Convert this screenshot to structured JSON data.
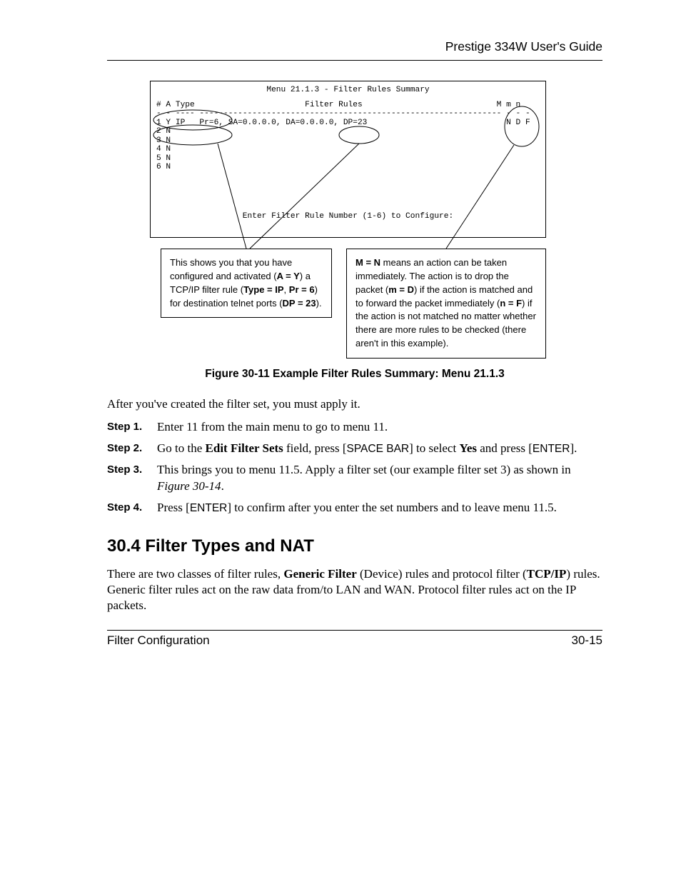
{
  "header": {
    "guide_title": "Prestige 334W User's Guide"
  },
  "terminal": {
    "title": "Menu 21.1.3 - Filter Rules Summary",
    "col_header": "# A Type                       Filter Rules                            M m n",
    "col_divider": "- - ---- --------------------------------------------------------------- - - -",
    "rows": [
      "1 Y IP   Pr=6, SA=0.0.0.0, DA=0.0.0.0, DP=23                             N D F",
      "2 N",
      "3 N",
      "4 N",
      "5 N",
      "6 N"
    ],
    "prompt": "Enter Filter Rule Number (1-6) to Configure:"
  },
  "callouts": {
    "left": {
      "t1": "This shows you that you have configured and activated (",
      "b1": "A = Y",
      "t2": ") a TCP/IP filter rule (",
      "b2": "Type = IP",
      "t3": ", ",
      "b3": "Pr = 6",
      "t4": ") for destination telnet ports (",
      "b4": "DP = 23",
      "t5": ")."
    },
    "right": {
      "b1": "M = N",
      "t1": " means an action can be taken immediately. The action is to drop the packet (",
      "b2": "m = D",
      "t2": ") if the action is matched and to forward the packet immediately (",
      "b3": "n = F",
      "t3": ") if the action is not matched no matter whether there are more rules to be checked (there aren't in this example)."
    }
  },
  "figure_caption": "Figure 30-11 Example Filter Rules Summary: Menu 21.1.3",
  "intro_para": "After you've created the filter set, you must apply it.",
  "steps": [
    {
      "label": "Step 1.",
      "plain": "Enter 11 from the main menu to go to menu 11."
    },
    {
      "label": "Step 2.",
      "pre": "Go to the ",
      "b1": "Edit Filter Sets",
      "mid1": " field, press [",
      "ss1": "SPACE BAR",
      "mid2": "] to select ",
      "b2": "Yes",
      "mid3": " and press [",
      "ss2": "ENTER",
      "post": "]."
    },
    {
      "label": "Step 3.",
      "pre": "This brings you to menu 11.5. Apply a filter set (our example filter set 3) as shown in ",
      "it": "Figure 30-14",
      "post": "."
    },
    {
      "label": "Step 4.",
      "pre": "Press [",
      "ss1": "ENTER",
      "post": "] to confirm after you enter the set numbers and to leave menu 11.5."
    }
  ],
  "section_heading": "30.4  Filter Types and NAT",
  "section_para": {
    "t1": "There are two classes of filter rules, ",
    "b1": "Generic Filter",
    "t2": " (Device) rules and protocol filter (",
    "b2": "TCP/IP",
    "t3": ") rules. Generic filter rules act on the raw data from/to LAN and WAN. Protocol filter rules act on the IP packets."
  },
  "footer": {
    "left": "Filter Configuration",
    "right": "30-15"
  }
}
